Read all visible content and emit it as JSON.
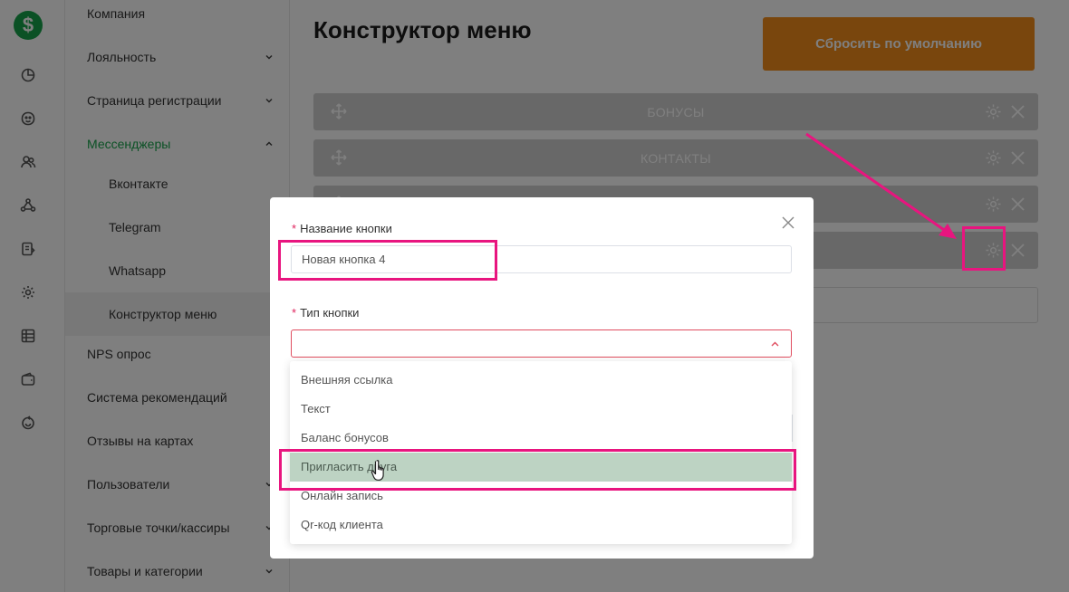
{
  "app": {
    "logo_glyph": "$",
    "accent_color": "#16a34a",
    "warn_color": "#f28c1a",
    "annotation_color": "#e8157f"
  },
  "rail": {
    "icons": [
      "chart-icon",
      "loyalty-icon",
      "users-icon",
      "recommend-icon",
      "document-icon",
      "settings-icon",
      "table-icon",
      "wallet-icon",
      "refresh-icon"
    ]
  },
  "sidebar": {
    "items": [
      {
        "label": "Компания",
        "chevron": ""
      },
      {
        "label": "Лояльность",
        "chevron": "down"
      },
      {
        "label": "Страница регистрации",
        "chevron": "down"
      },
      {
        "label": "Мессенджеры",
        "chevron": "up"
      },
      {
        "label": "Вконтакте",
        "chevron": ""
      },
      {
        "label": "Telegram",
        "chevron": ""
      },
      {
        "label": "Whatsapp",
        "chevron": ""
      },
      {
        "label": "Конструктор меню",
        "chevron": ""
      },
      {
        "label": "NPS опрос",
        "chevron": ""
      },
      {
        "label": "Система рекомендаций",
        "chevron": ""
      },
      {
        "label": "Отзывы на картах",
        "chevron": ""
      },
      {
        "label": "Пользователи",
        "chevron": "down"
      },
      {
        "label": "Торговые точки/кассиры",
        "chevron": "down"
      },
      {
        "label": "Товары и категории",
        "chevron": "down"
      }
    ]
  },
  "main": {
    "title": "Конструктор меню",
    "reset_label": "Сбросить по умолчанию",
    "rows": [
      {
        "label": "БОНУСЫ"
      },
      {
        "label": "КОНТАКТЫ"
      },
      {
        "label": ""
      },
      {
        "label": ""
      }
    ]
  },
  "modal": {
    "name_label": "Название кнопки",
    "name_value": "Новая кнопка 4",
    "type_label": "Тип кнопки",
    "type_value": "",
    "required_mark": "*",
    "options": [
      {
        "label": "Внешняя ссылка",
        "highlighted": false
      },
      {
        "label": "Текст",
        "highlighted": false
      },
      {
        "label": "Баланс бонусов",
        "highlighted": false
      },
      {
        "label": "Пригласить друга",
        "highlighted": true
      },
      {
        "label": "Онлайн запись",
        "highlighted": false
      },
      {
        "label": "Qr-код клиента",
        "highlighted": false
      }
    ]
  }
}
